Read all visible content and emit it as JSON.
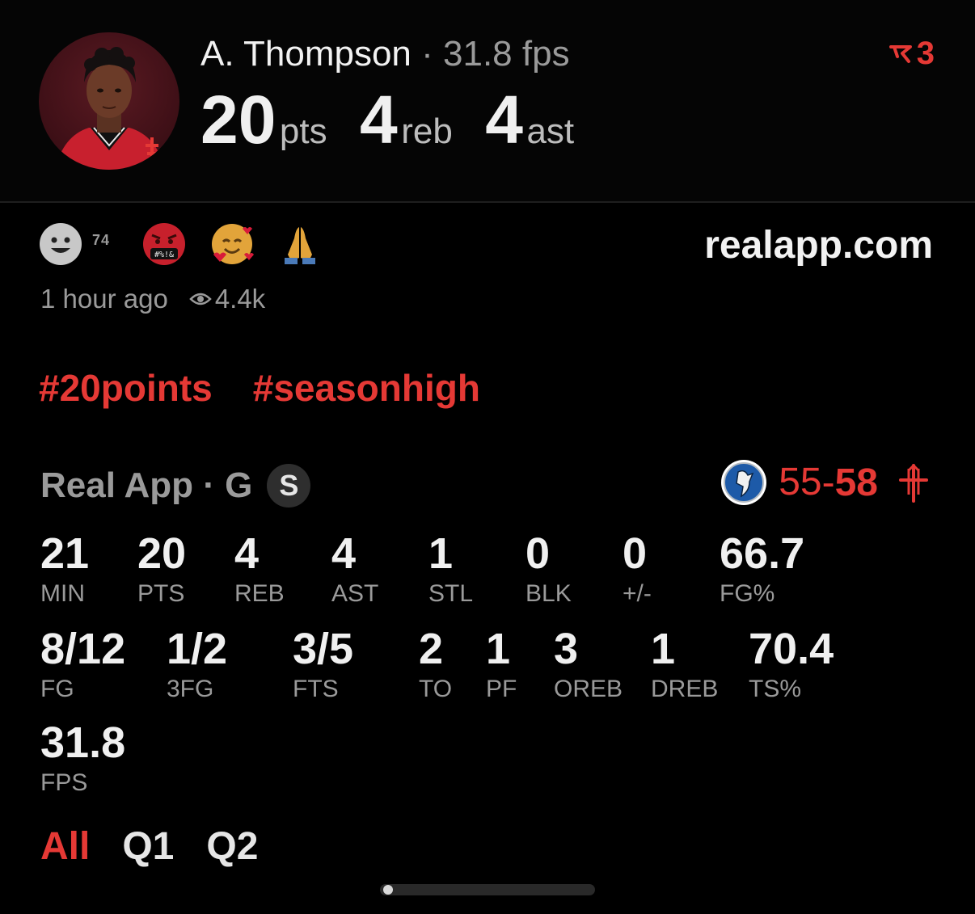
{
  "header": {
    "player_name": "A. Thompson",
    "separator": "·",
    "fps_text": "31.8 fps",
    "pts": "20",
    "pts_unit": "pts",
    "reb": "4",
    "reb_unit": "reb",
    "ast": "4",
    "ast_unit": "ast",
    "badge_count": "3",
    "badge_icon": "flag-icon"
  },
  "reactions": {
    "count": "74",
    "items": [
      "smile-icon",
      "cursing-face-icon",
      "smiling-hearts-icon",
      "praying-hands-icon"
    ]
  },
  "brand": "realapp.com",
  "meta": {
    "time": "1 hour ago",
    "views": "4.4k"
  },
  "tags": [
    "#20points",
    "#seasonhigh"
  ],
  "game": {
    "title": "Real App · G",
    "badge": "S",
    "away_score": "55",
    "dash": "-",
    "home_score": "58"
  },
  "stats": [
    {
      "v": "21",
      "l": "MIN"
    },
    {
      "v": "20",
      "l": "PTS"
    },
    {
      "v": "4",
      "l": "REB"
    },
    {
      "v": "4",
      "l": "AST"
    },
    {
      "v": "1",
      "l": "STL"
    },
    {
      "v": "0",
      "l": "BLK"
    },
    {
      "v": "0",
      "l": "+/-"
    },
    {
      "v": "66.7",
      "l": "FG%"
    },
    {
      "v": "8/12",
      "l": "FG"
    },
    {
      "v": "1/2",
      "l": "3FG"
    },
    {
      "v": "3/5",
      "l": "FTS"
    },
    {
      "v": "2",
      "l": "TO"
    },
    {
      "v": "1",
      "l": "PF"
    },
    {
      "v": "3",
      "l": "OREB"
    },
    {
      "v": "1",
      "l": "DREB"
    },
    {
      "v": "70.4",
      "l": "TS%"
    },
    {
      "v": "31.8",
      "l": "FPS"
    }
  ],
  "quarters": [
    "All",
    "Q1",
    "Q2"
  ],
  "colors": {
    "accent": "#e53935",
    "muted": "#9a9a9a",
    "background": "#000000"
  }
}
